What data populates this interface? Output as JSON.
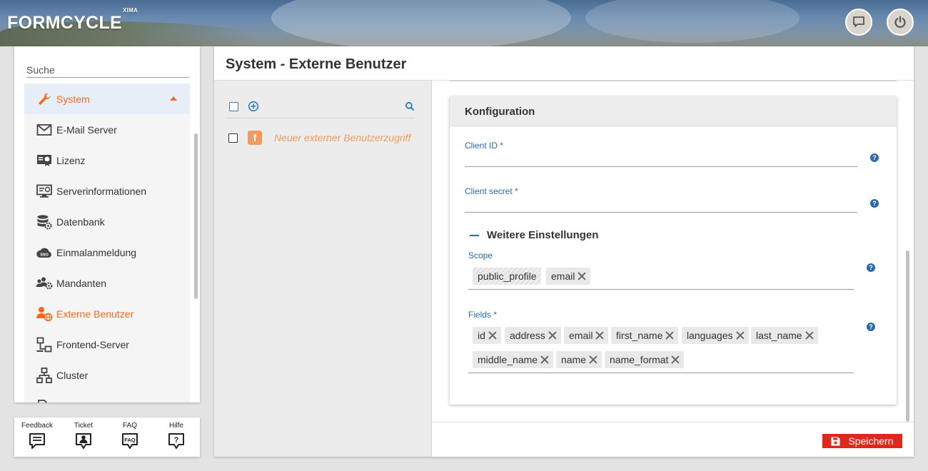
{
  "header": {
    "logo_text": "FORMCYCLE",
    "logo_sup": "XIMA",
    "buttons": [
      "chat-icon",
      "power-icon"
    ]
  },
  "sidebar": {
    "search_placeholder": "Suche",
    "items": [
      {
        "label": "System",
        "icon": "wrench-icon",
        "state": "expanded"
      },
      {
        "label": "E-Mail Server",
        "icon": "envelope-icon"
      },
      {
        "label": "Lizenz",
        "icon": "certificate-icon"
      },
      {
        "label": "Serverinformationen",
        "icon": "monitor-info-icon"
      },
      {
        "label": "Datenbank",
        "icon": "database-gear-icon"
      },
      {
        "label": "Einmalanmeldung",
        "icon": "sso-cloud-icon"
      },
      {
        "label": "Mandanten",
        "icon": "users-gear-icon"
      },
      {
        "label": "Externe Benutzer",
        "icon": "user-globe-icon",
        "state": "active"
      },
      {
        "label": "Frontend-Server",
        "icon": "network-servers-icon"
      },
      {
        "label": "Cluster",
        "icon": "cluster-icon"
      }
    ]
  },
  "help": {
    "items": [
      {
        "label": "Feedback",
        "icon": "feedback-icon"
      },
      {
        "label": "Ticket",
        "icon": "ticket-icon"
      },
      {
        "label": "FAQ",
        "icon": "faq-icon"
      },
      {
        "label": "Hilfe",
        "icon": "help-icon"
      }
    ]
  },
  "main": {
    "title": "System - Externe Benutzer",
    "list": {
      "rows": [
        {
          "label": "Neuer externer Benutzerzugriff",
          "badge": "f"
        }
      ]
    },
    "config": {
      "title": "Konfiguration",
      "client_id_label": "Client ID *",
      "client_id_value": "",
      "client_secret_label": "Client secret *",
      "client_secret_value": "",
      "more_settings": "Weitere Einstellungen",
      "scope_label": "Scope",
      "scope_tags": [
        "public_profile",
        "email"
      ],
      "fields_label": "Fields *",
      "fields_tags": [
        "id",
        "address",
        "email",
        "first_name",
        "languages",
        "last_name",
        "middle_name",
        "name",
        "name_format"
      ],
      "help_glyph": "?"
    },
    "save_label": "Speichern"
  },
  "colors": {
    "accent": "#f26a1b",
    "link_blue": "#2a6aa3",
    "save_red": "#e0271c",
    "fb_badge": "#f29b5e"
  }
}
